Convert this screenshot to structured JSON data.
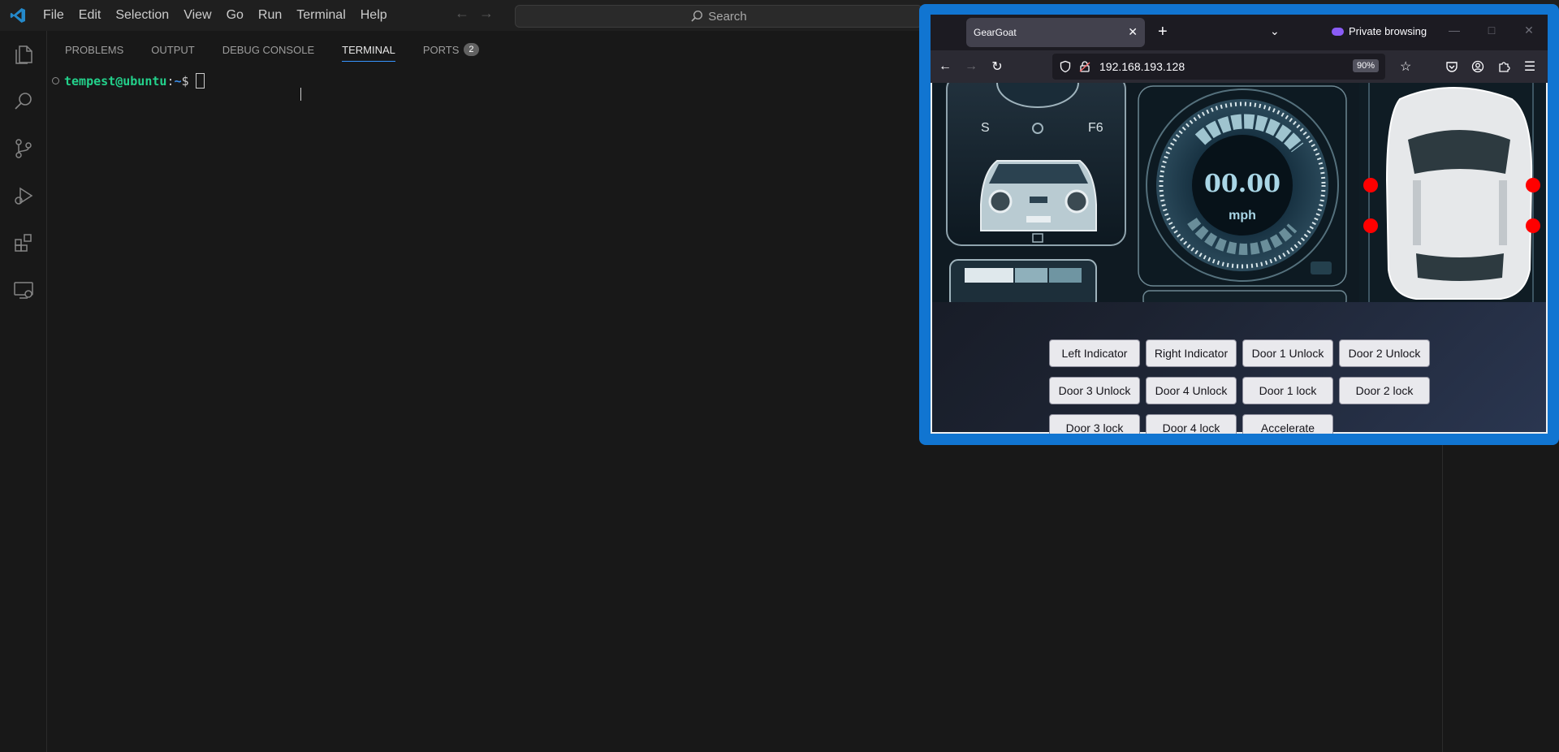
{
  "vscode": {
    "menu": [
      "File",
      "Edit",
      "Selection",
      "View",
      "Go",
      "Run",
      "Terminal",
      "Help"
    ],
    "search_placeholder": "Search",
    "panel_tabs": [
      "PROBLEMS",
      "OUTPUT",
      "DEBUG CONSOLE",
      "TERMINAL",
      "PORTS"
    ],
    "ports_badge": "2",
    "terminal": {
      "user_host": "tempest@ubuntu",
      "sep": ":",
      "path": "~",
      "symbol": "$"
    }
  },
  "firefox": {
    "tab_title": "GearGoat",
    "private_label": "Private browsing",
    "url": "192.168.193.128",
    "zoom": "90%"
  },
  "dashboard": {
    "speed": "00.00",
    "unit": "mph",
    "gear_left": "S",
    "gear_right": "F6",
    "accent_color": "#e8ecef",
    "door_indicator_color": "#ff0000"
  },
  "controls": [
    "Left Indicator",
    "Right Indicator",
    "Door 1 Unlock",
    "Door 2 Unlock",
    "Door 3 Unlock",
    "Door 4 Unlock",
    "Door 1 lock",
    "Door 2 lock",
    "Door 3 lock",
    "Door 4 lock",
    "Accelerate"
  ],
  "colors": {
    "vscode_accent": "#3794ff",
    "firefox_frame": "#1175d1",
    "prompt_user": "#23d18b",
    "prompt_path": "#3b8eea"
  }
}
